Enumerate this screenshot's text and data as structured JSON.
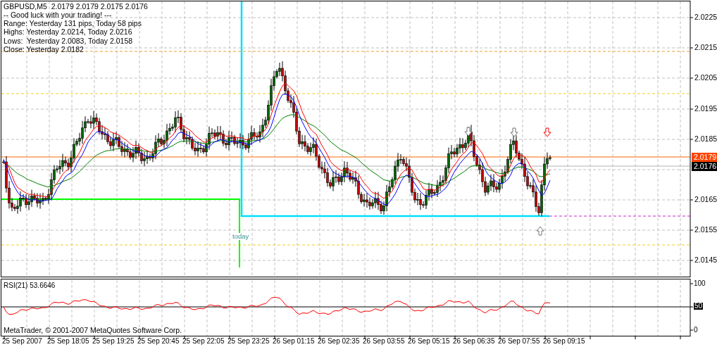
{
  "symbol_info": "GBPUSD,M5  2.0179 2.0179 2.0175 2.0176",
  "info_lines": [
    "-- Good luck with your trading! ---",
    "Range: Yesterday 131 pips, Today 58 pips",
    "Highs: Yesterday 2.0214, Today 2.0216",
    "Lows:  Yesterday 2.0083, Today 2.0158",
    "Close: Yesterday 2.0182"
  ],
  "price_axis": {
    "ticks": [
      "2.0225",
      "2.0215",
      "2.0205",
      "2.0195",
      "2.0185",
      "2.0165",
      "2.0155",
      "2.0145"
    ],
    "bid_label": "2.0179",
    "current_label": "2.0176"
  },
  "today_marker": "today",
  "rsi": {
    "title": "RSI(21) 53.6646",
    "ticks": [
      "100",
      "50",
      "0"
    ]
  },
  "copyright": "MetaTrader, © 2001-2007 MetaQuotes Software Corp.",
  "time_axis": [
    "25 Sep 2007",
    "25 Sep 18:05",
    "25 Sep 19:25",
    "25 Sep 20:45",
    "25 Sep 22:05",
    "25 Sep 23:25",
    "26 Sep 01:15",
    "26 Sep 02:35",
    "26 Sep 03:55",
    "26 Sep 05:15",
    "26 Sep 06:35",
    "26 Sep 07:55",
    "26 Sep 09:15"
  ]
}
